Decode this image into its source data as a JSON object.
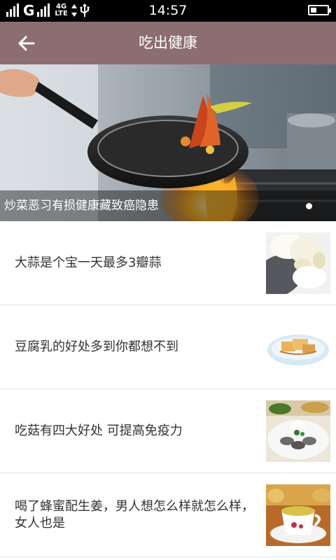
{
  "status_bar": {
    "carrier": "G",
    "network_top": "4G",
    "network_bottom": "LTE",
    "time": "14:57",
    "battery_level": 0.35
  },
  "header": {
    "title": "吃出健康",
    "back_icon": "arrow-left-icon"
  },
  "banner": {
    "caption": "炒菜恶习有损健康藏致癌隐患",
    "page_indicator": {
      "count": 1,
      "active": 1
    }
  },
  "articles": [
    {
      "title": "大蒜是个宝一天最多3瓣蒜",
      "thumbnail": "garlic"
    },
    {
      "title": "豆腐乳的好处多到你都想不到",
      "thumbnail": "tofu-bowl"
    },
    {
      "title": "吃菇有四大好处 可提高免疫力",
      "thumbnail": "mushroom-platter"
    },
    {
      "title": "喝了蜂蜜配生姜，男人想怎么样就怎么样，女人也是",
      "thumbnail": "honey-ginger-tea"
    }
  ]
}
